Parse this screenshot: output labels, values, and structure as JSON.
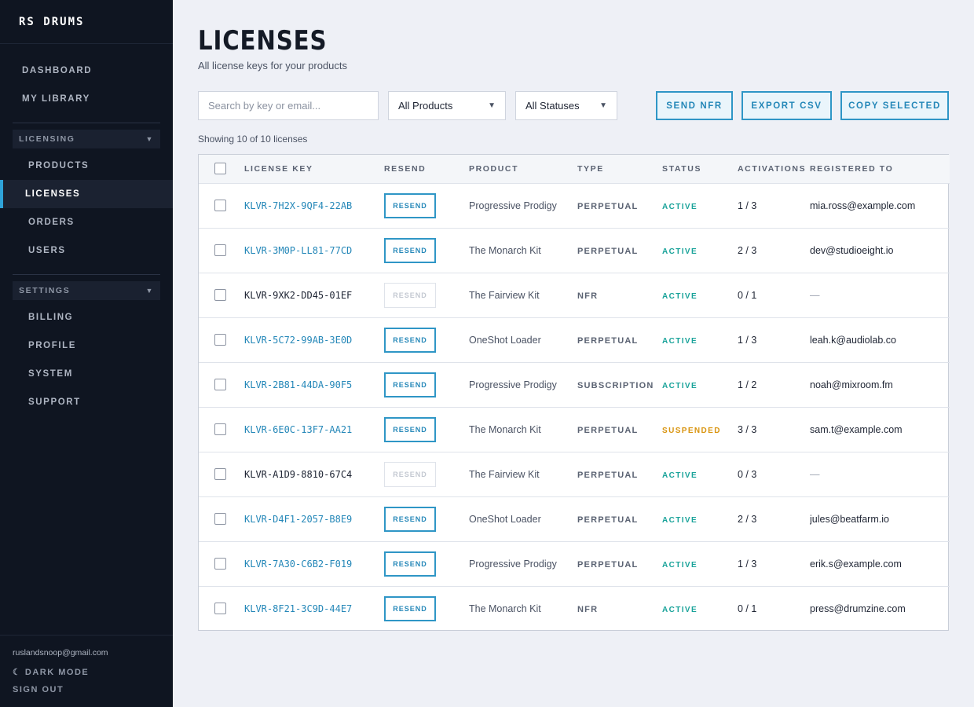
{
  "brand": "RS DRUMS",
  "nav": {
    "top": [
      {
        "label": "DASHBOARD",
        "name": "nav-dashboard"
      },
      {
        "label": "MY LIBRARY",
        "name": "nav-my-library"
      }
    ],
    "licensing": {
      "heading": "LICENSING",
      "items": [
        {
          "label": "PRODUCTS",
          "name": "nav-products",
          "active": false
        },
        {
          "label": "LICENSES",
          "name": "nav-licenses",
          "active": true
        },
        {
          "label": "ORDERS",
          "name": "nav-orders",
          "active": false
        },
        {
          "label": "USERS",
          "name": "nav-users",
          "active": false
        }
      ]
    },
    "settings": {
      "heading": "SETTINGS",
      "items": [
        {
          "label": "BILLING",
          "name": "nav-billing"
        },
        {
          "label": "PROFILE",
          "name": "nav-profile"
        },
        {
          "label": "SYSTEM",
          "name": "nav-system"
        },
        {
          "label": "SUPPORT",
          "name": "nav-support"
        }
      ]
    },
    "caret": "▼"
  },
  "footer": {
    "email": "ruslandsnoop@gmail.com",
    "dark_mode": "☾ DARK MODE",
    "sign_out": "SIGN OUT"
  },
  "page": {
    "title": "LICENSES",
    "subtitle": "All license keys for your products"
  },
  "toolbar": {
    "search_placeholder": "Search by key or email...",
    "product_filter": "All Products",
    "status_filter": "All Statuses",
    "caret": "▼",
    "send_nfr": "SEND NFR",
    "export_csv": "EXPORT CSV",
    "copy_selected": "COPY SELECTED"
  },
  "count_text": "Showing 10 of 10 licenses",
  "colors": {
    "accent": "#2487b8",
    "active": "#1aa39a",
    "suspended": "#d9940f"
  },
  "table": {
    "columns": [
      "LICENSE KEY",
      "RESEND",
      "PRODUCT",
      "TYPE",
      "STATUS",
      "ACTIVATIONS",
      "REGISTERED TO"
    ],
    "resend_label": "RESEND",
    "rows": [
      {
        "key": "KLVR-7H2X-9QF4-22AB",
        "resend_enabled": true,
        "product": "Progressive Prodigy",
        "type": "PERPETUAL",
        "status": "ACTIVE",
        "activations": "1 / 3",
        "registered": "mia.ross@example.com"
      },
      {
        "key": "KLVR-3M0P-LL81-77CD",
        "resend_enabled": true,
        "product": "The Monarch Kit",
        "type": "PERPETUAL",
        "status": "ACTIVE",
        "activations": "2 / 3",
        "registered": "dev@studioeight.io"
      },
      {
        "key": "KLVR-9XK2-DD45-01EF",
        "resend_enabled": false,
        "product": "The Fairview Kit",
        "type": "NFR",
        "status": "ACTIVE",
        "activations": "0 / 1",
        "registered": "—"
      },
      {
        "key": "KLVR-5C72-99AB-3E0D",
        "resend_enabled": true,
        "product": "OneShot Loader",
        "type": "PERPETUAL",
        "status": "ACTIVE",
        "activations": "1 / 3",
        "registered": "leah.k@audiolab.co"
      },
      {
        "key": "KLVR-2B81-44DA-90F5",
        "resend_enabled": true,
        "product": "Progressive Prodigy",
        "type": "SUBSCRIPTION",
        "status": "ACTIVE",
        "activations": "1 / 2",
        "registered": "noah@mixroom.fm"
      },
      {
        "key": "KLVR-6E0C-13F7-AA21",
        "resend_enabled": true,
        "product": "The Monarch Kit",
        "type": "PERPETUAL",
        "status": "SUSPENDED",
        "activations": "3 / 3",
        "registered": "sam.t@example.com"
      },
      {
        "key": "KLVR-A1D9-8810-67C4",
        "resend_enabled": false,
        "product": "The Fairview Kit",
        "type": "PERPETUAL",
        "status": "ACTIVE",
        "activations": "0 / 3",
        "registered": "—"
      },
      {
        "key": "KLVR-D4F1-2057-B8E9",
        "resend_enabled": true,
        "product": "OneShot Loader",
        "type": "PERPETUAL",
        "status": "ACTIVE",
        "activations": "2 / 3",
        "registered": "jules@beatfarm.io"
      },
      {
        "key": "KLVR-7A30-C6B2-F019",
        "resend_enabled": true,
        "product": "Progressive Prodigy",
        "type": "PERPETUAL",
        "status": "ACTIVE",
        "activations": "1 / 3",
        "registered": "erik.s@example.com"
      },
      {
        "key": "KLVR-8F21-3C9D-44E7",
        "resend_enabled": true,
        "product": "The Monarch Kit",
        "type": "NFR",
        "status": "ACTIVE",
        "activations": "0 / 1",
        "registered": "press@drumzine.com"
      }
    ]
  }
}
